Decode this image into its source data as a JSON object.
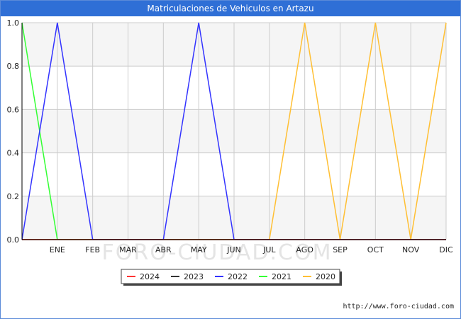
{
  "window": {
    "title": "Matriculaciones de Vehiculos en Artazu"
  },
  "source_credit": "http://www.foro-ciudad.com",
  "watermark": "FORO-CIUDAD.COM",
  "colors": {
    "title_bg": "#2f6fd6",
    "grid": "#cccccc",
    "band": "#f5f5f5"
  },
  "chart_data": {
    "type": "line",
    "title": "Matriculaciones de Vehiculos en Artazu",
    "xlabel": "",
    "ylabel": "",
    "categories": [
      "ENE",
      "FEB",
      "MAR",
      "ABR",
      "MAY",
      "JUN",
      "JUL",
      "AGO",
      "SEP",
      "OCT",
      "NOV",
      "DIC"
    ],
    "ylim": [
      0,
      1.0
    ],
    "yticks": [
      "0.0",
      "0.2",
      "0.4",
      "0.6",
      "0.8",
      "1.0"
    ],
    "grid": true,
    "legend_position": "bottom-center",
    "series": [
      {
        "name": "2024",
        "color": "#ff3333",
        "start": 0,
        "values": [
          0,
          0,
          0,
          0,
          0,
          0,
          0,
          0,
          0,
          0,
          0,
          0
        ]
      },
      {
        "name": "2023",
        "color": "#333333",
        "start": 0,
        "values": [
          0,
          0,
          0,
          0,
          0,
          0,
          0,
          0,
          0,
          0,
          0,
          0
        ]
      },
      {
        "name": "2022",
        "color": "#3333ff",
        "start": 0,
        "values": [
          1,
          0,
          0,
          0,
          1,
          0,
          0,
          0,
          0,
          0,
          0,
          0
        ]
      },
      {
        "name": "2021",
        "color": "#33ff33",
        "start": 1,
        "values": [
          0,
          0,
          0,
          0,
          0,
          0,
          0,
          0,
          0,
          0,
          0,
          0
        ]
      },
      {
        "name": "2020",
        "color": "#ffbf33",
        "start": 0,
        "values": [
          0,
          0,
          0,
          0,
          0,
          0,
          0,
          1,
          0,
          1,
          0,
          1
        ]
      }
    ]
  }
}
